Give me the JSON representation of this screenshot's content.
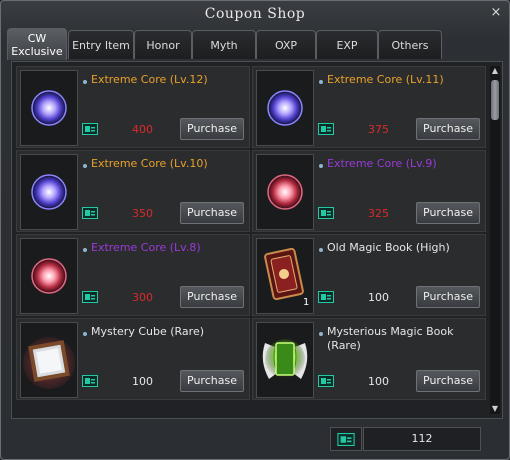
{
  "window": {
    "title": "Coupon Shop",
    "close_glyph": "×"
  },
  "tabs": [
    {
      "label": "CW\nExclusive",
      "active": true
    },
    {
      "label": "Entry Item"
    },
    {
      "label": "Honor"
    },
    {
      "label": "Myth"
    },
    {
      "label": "OXP"
    },
    {
      "label": "EXP"
    },
    {
      "label": "Others"
    }
  ],
  "items": [
    {
      "name": "Extreme Core (Lv.12)",
      "price": "400",
      "rarity_color": "#e8a12a",
      "price_color": "#d82a2a",
      "icon": "extreme-core-blue-icon",
      "button": "Purchase"
    },
    {
      "name": "Extreme Core (Lv.11)",
      "price": "375",
      "rarity_color": "#e8a12a",
      "price_color": "#d82a2a",
      "icon": "extreme-core-blue-icon",
      "button": "Purchase"
    },
    {
      "name": "Extreme Core (Lv.10)",
      "price": "350",
      "rarity_color": "#e8a12a",
      "price_color": "#d82a2a",
      "icon": "extreme-core-blue-icon",
      "button": "Purchase"
    },
    {
      "name": "Extreme Core (Lv.9)",
      "price": "325",
      "rarity_color": "#9a3ad8",
      "price_color": "#d82a2a",
      "icon": "extreme-core-red-icon",
      "button": "Purchase"
    },
    {
      "name": "Extreme Core (Lv.8)",
      "price": "300",
      "rarity_color": "#9a3ad8",
      "price_color": "#d82a2a",
      "icon": "extreme-core-red-icon",
      "button": "Purchase"
    },
    {
      "name": "Old Magic Book (High)",
      "price": "100",
      "rarity_color": "#e6e6e6",
      "price_color": "#e6e6e6",
      "icon": "old-magic-book-icon",
      "badge": "1",
      "button": "Purchase"
    },
    {
      "name": "Mystery Cube (Rare)",
      "price": "100",
      "rarity_color": "#e6e6e6",
      "price_color": "#e6e6e6",
      "icon": "mystery-cube-icon",
      "button": "Purchase"
    },
    {
      "name": "Mysterious Magic Book (Rare)",
      "price": "100",
      "rarity_color": "#e6e6e6",
      "price_color": "#e6e6e6",
      "icon": "mysterious-magic-book-icon",
      "button": "Purchase"
    }
  ],
  "scrollbar": {
    "up_glyph": "▲",
    "down_glyph": "▼"
  },
  "footer": {
    "balance": "112",
    "currency_icon": "coupon-icon"
  },
  "colors": {
    "gold": "#e8a12a",
    "purple": "#9a3ad8",
    "price_red": "#d82a2a",
    "coupon_green": "#21c9a4"
  }
}
